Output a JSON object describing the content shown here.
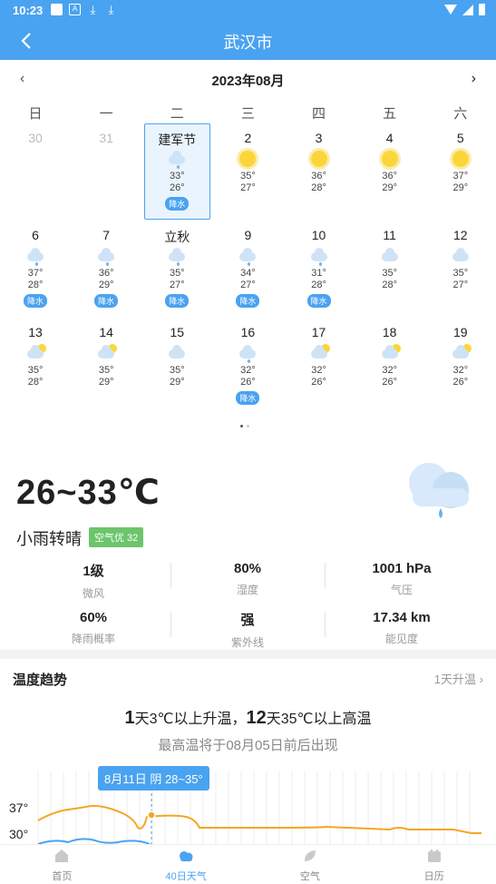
{
  "status": {
    "time": "10:23"
  },
  "header": {
    "title": "武汉市"
  },
  "calendar": {
    "month": "2023年08月",
    "weekdays": [
      "日",
      "一",
      "二",
      "三",
      "四",
      "五",
      "六"
    ],
    "weeks": [
      [
        {
          "day": "30",
          "grey": true
        },
        {
          "day": "31",
          "grey": true
        },
        {
          "day": "建军节",
          "icon": "rain-cloud-icon",
          "hi": "33°",
          "lo": "26°",
          "badge": "降水",
          "selected": true
        },
        {
          "day": "2",
          "icon": "sun-icon",
          "hi": "35°",
          "lo": "27°"
        },
        {
          "day": "3",
          "icon": "sun-icon",
          "hi": "36°",
          "lo": "28°"
        },
        {
          "day": "4",
          "icon": "sun-icon",
          "hi": "36°",
          "lo": "29°"
        },
        {
          "day": "5",
          "icon": "sun-icon",
          "hi": "37°",
          "lo": "29°"
        }
      ],
      [
        {
          "day": "6",
          "icon": "rain-cloud-icon",
          "hi": "37°",
          "lo": "28°",
          "badge": "降水"
        },
        {
          "day": "7",
          "icon": "rain-cloud-icon",
          "hi": "36°",
          "lo": "29°",
          "badge": "降水"
        },
        {
          "day": "立秋",
          "icon": "rain-cloud-icon",
          "hi": "35°",
          "lo": "27°",
          "badge": "降水"
        },
        {
          "day": "9",
          "icon": "rain-cloud-icon",
          "hi": "34°",
          "lo": "27°",
          "badge": "降水"
        },
        {
          "day": "10",
          "icon": "rain-cloud-icon",
          "hi": "31°",
          "lo": "28°",
          "badge": "降水"
        },
        {
          "day": "11",
          "icon": "cloud-icon",
          "hi": "35°",
          "lo": "28°"
        },
        {
          "day": "12",
          "icon": "cloud-icon",
          "hi": "35°",
          "lo": "27°"
        }
      ],
      [
        {
          "day": "13",
          "icon": "partly-cloudy-icon",
          "hi": "35°",
          "lo": "28°"
        },
        {
          "day": "14",
          "icon": "partly-cloudy-icon",
          "hi": "35°",
          "lo": "29°"
        },
        {
          "day": "15",
          "icon": "cloud-icon",
          "hi": "35°",
          "lo": "29°"
        },
        {
          "day": "16",
          "icon": "rain-cloud-icon",
          "hi": "32°",
          "lo": "26°",
          "badge": "降水"
        },
        {
          "day": "17",
          "icon": "partly-cloudy-icon",
          "hi": "32°",
          "lo": "26°"
        },
        {
          "day": "18",
          "icon": "partly-cloudy-icon",
          "hi": "32°",
          "lo": "26°"
        },
        {
          "day": "19",
          "icon": "partly-cloudy-icon",
          "hi": "32°",
          "lo": "26°"
        }
      ]
    ]
  },
  "today": {
    "temp_range": "26~33℃",
    "desc": "小雨转晴",
    "aqi": "空气优 32",
    "stats": [
      {
        "value": "1级",
        "label": "微风"
      },
      {
        "value": "80%",
        "label": "湿度"
      },
      {
        "value": "1001 hPa",
        "label": "气压"
      },
      {
        "value": "60%",
        "label": "降雨概率"
      },
      {
        "value": "强",
        "label": "紫外线"
      },
      {
        "value": "17.34 km",
        "label": "能见度"
      }
    ]
  },
  "trend": {
    "title": "温度趋势",
    "link": "1天升温",
    "head_n1": "1",
    "head_t1": "天3℃以上升温，",
    "head_n2": "12",
    "head_t2": "天35℃以上高温",
    "sub": "最高温将于08月05日前后出现",
    "tooltip": "8月11日 阴 28~35°",
    "y_label_hi": "37°",
    "y_label_lo": "30°"
  },
  "nav": {
    "tabs": [
      {
        "label": "首页",
        "icon": "home-icon"
      },
      {
        "label": "40日天气",
        "icon": "cloud-icon",
        "active": true
      },
      {
        "label": "空气",
        "icon": "leaf-icon"
      },
      {
        "label": "日历",
        "icon": "calendar-icon"
      }
    ]
  },
  "colors": {
    "accent": "#4aa3f0",
    "high_line": "#f5a623",
    "low_line": "#4aa3f0",
    "aqi_good": "#6cc56b"
  }
}
